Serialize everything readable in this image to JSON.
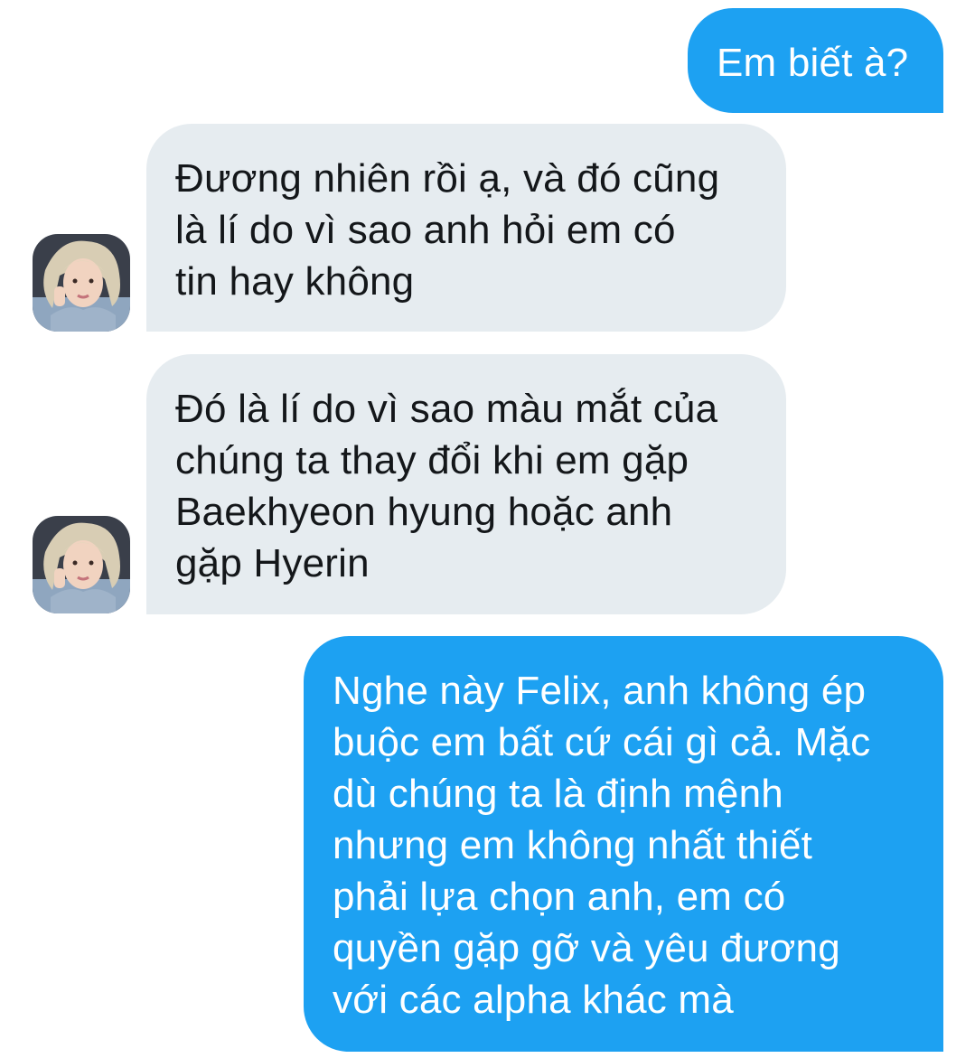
{
  "conversation": {
    "messages": [
      {
        "sender": "me",
        "text": "Em biết à?"
      },
      {
        "sender": "other",
        "text": "Đương nhiên rồi ạ, và đó cũng\nlà lí do vì sao anh hỏi em có\ntin hay không"
      },
      {
        "sender": "other",
        "text": "Đó là lí do vì sao màu mắt của\nchúng ta thay đổi khi em gặp\nBaekhyeon hyung hoặc anh\ngặp Hyerin"
      },
      {
        "sender": "me",
        "text": "Nghe này Felix, anh không ép\nbuộc em bất cứ cái gì cả. Mặc\ndù chúng ta là định mệnh\nnhưng em không nhất thiết\nphải lựa chọn anh, em có\nquyền gặp gỡ và yêu đương\nvới các alpha khác mà"
      }
    ]
  },
  "colors": {
    "sent_bubble": "#1da1f2",
    "received_bubble": "#e6ecf0",
    "received_text": "#14171a",
    "background": "#ffffff"
  }
}
